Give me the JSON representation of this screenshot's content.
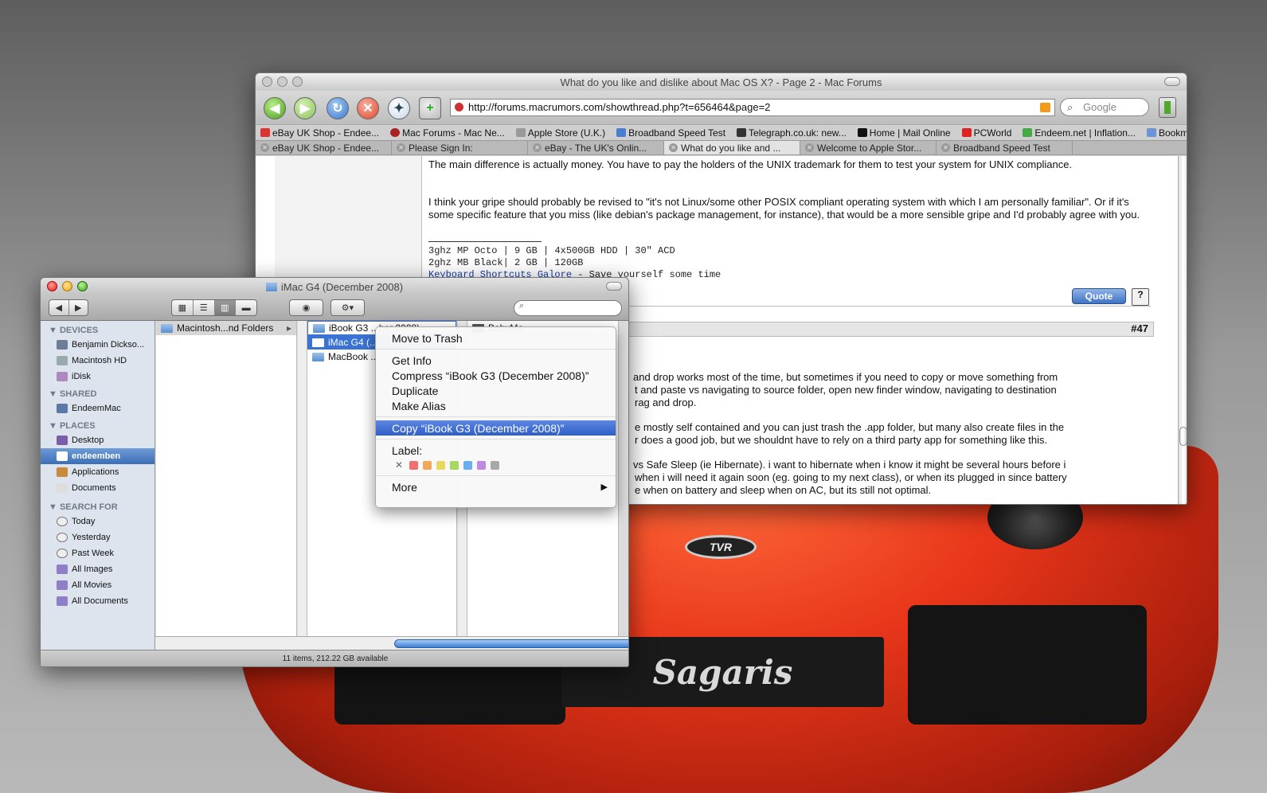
{
  "desktop": {
    "plate_text": "Sagaris",
    "badge_text": "TVR"
  },
  "browser": {
    "title": "What do you like and dislike about Mac OS X? - Page 2 - Mac Forums",
    "url": "http://forums.macrumors.com/showthread.php?t=656464&page=2",
    "search_placeholder": "Google",
    "bookmarks": [
      "eBay UK Shop - Endee...",
      "Mac Forums - Mac Ne...",
      "Apple Store (U.K.)",
      "Broadband Speed Test",
      "Telegraph.co.uk: new...",
      "Home | Mail Online",
      "PCWorld",
      "Endeem.net | Inflation...",
      "Bookmarks"
    ],
    "tabs": [
      "eBay UK Shop - Endee...",
      "Please Sign In:",
      "eBay - The UK's Onlin...",
      "What do you like and ...",
      "Welcome to Apple Stor...",
      "Broadband Speed Test"
    ],
    "post1": {
      "p1": "The main difference is actually money. You have to pay the holders of the UNIX trademark for them to test your system for UNIX compliance.",
      "p2": "I think your gripe should probably be revised to \"it's not Linux/some other POSIX compliant operating system with which I am personally familiar\". Or if it's some specific feature that you miss (like debian's package management, for instance), that would be a more sensible gripe and I'd probably agree with you.",
      "sig_line1": "3ghz MP Octo | 9 GB | 4x500GB HDD | 30\" ACD",
      "sig_line2": "2ghz MB Black| 2 GB | 120GB",
      "sig_link": "Keyboard Shortcuts Galore",
      "sig_tail": " - Save yourself some time",
      "quote_label": "Quote"
    },
    "post2": {
      "number": "#47",
      "l1": "and drop works most of the time, but sometimes if you need to copy or move something from",
      "l2": "t and paste vs navigating to source folder, open new finder window, navigating to destination",
      "l3": "rag and drop.",
      "l4": "e mostly self contained and you can just trash the .app folder, but many also create files in the",
      "l5": "r does a good job, but we shouldnt have to rely on a third party app for something like this.",
      "l6": "vs Safe Sleep (ie Hibernate). i want to hibernate when i know it might be several hours before i",
      "l7": "when i will need it again soon (eg. going to my next class), or when its plugged in since battery",
      "l8": "e when on battery and sleep when on AC, but its still not optimal."
    }
  },
  "finder": {
    "title": "iMac G4 (December 2008)",
    "status": "11 items, 212.22 GB available",
    "sidebar": {
      "devices_label": "DEVICES",
      "devices": [
        "Benjamin Dickso...",
        "Macintosh HD",
        "iDisk"
      ],
      "shared_label": "SHARED",
      "shared": [
        "EndeemMac"
      ],
      "places_label": "PLACES",
      "places": [
        "Desktop",
        "endeemben",
        "Applications",
        "Documents"
      ],
      "search_label": "SEARCH FOR",
      "search": [
        "Today",
        "Yesterday",
        "Past Week",
        "All Images",
        "All Movies",
        "All Documents"
      ]
    },
    "col1": [
      "Macintosh...nd Folders"
    ],
    "col2": [
      "iBook G3 ...ber 2008)",
      "iMac G4 (...",
      "MacBook ..."
    ],
    "col3": [
      "BabyMe"
    ]
  },
  "context_menu": {
    "items": [
      "Move to Trash",
      "Get Info",
      "Compress “iBook G3 (December 2008)”",
      "Duplicate",
      "Make Alias",
      "Copy “iBook G3 (December 2008)”",
      "Label:",
      "More"
    ],
    "label_colors": [
      "#f07070",
      "#f0a85a",
      "#e8d860",
      "#a8d860",
      "#6aaef0",
      "#c08ae0",
      "#a8a8a8"
    ]
  }
}
